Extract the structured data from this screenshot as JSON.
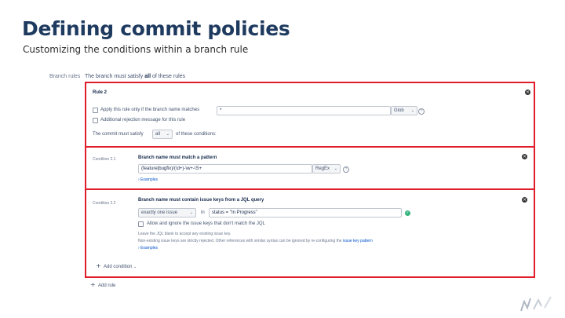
{
  "slide": {
    "title": "Defining commit policies",
    "subtitle": "Customizing the conditions within a branch rule"
  },
  "branch_rules": {
    "label": "Branch rules",
    "description_prefix": "The branch must satisfy",
    "description_emph": "all",
    "description_suffix": "of these rules"
  },
  "rule": {
    "title": "Rule 2",
    "apply_label": "Apply this rule only if the branch name matches",
    "branch_pattern_value": "*",
    "pattern_type": "Glob",
    "additional_rejection_label": "Additional rejection message for this rule",
    "satisfy_prefix": "The commit must satisfy",
    "satisfy_value": "all",
    "satisfy_suffix": "of these conditions:"
  },
  "condition1": {
    "label": "Condition 2.1",
    "title": "Branch name must match a pattern",
    "pattern_value": "(feature|bugfix)/(\\d+)-\\w+-\\S+",
    "pattern_type": "RegEx",
    "examples_link": "Examples"
  },
  "condition2": {
    "label": "Condition 2.2",
    "title": "Branch name must contain issue keys from a JQL query",
    "match_value": "exactly one issue",
    "in_label": "in",
    "jql_value": "status = \"In Progress\"",
    "allow_ignore_label": "Allow and ignore the issue keys that don't match the JQL",
    "help1": "Leave the JQL blank to accept any existing issue key.",
    "help2_prefix": "Non-existing issue keys are strictly rejected. Other references with similar syntax can be ignored by re-configuring the",
    "help2_link": "issue key pattern",
    "examples_link": "Examples",
    "add_condition": "Add condition"
  },
  "add_rule": "Add rule",
  "icons": {
    "remove": "close-circle-icon",
    "help": "question-circle-icon",
    "valid": "check-circle-icon",
    "chevron": "chevron-down-icon",
    "add": "plus-icon"
  },
  "colors": {
    "highlight_border": "#e01e2b",
    "title": "#1e3a5f",
    "link": "#0052cc",
    "valid": "#36b37e"
  }
}
